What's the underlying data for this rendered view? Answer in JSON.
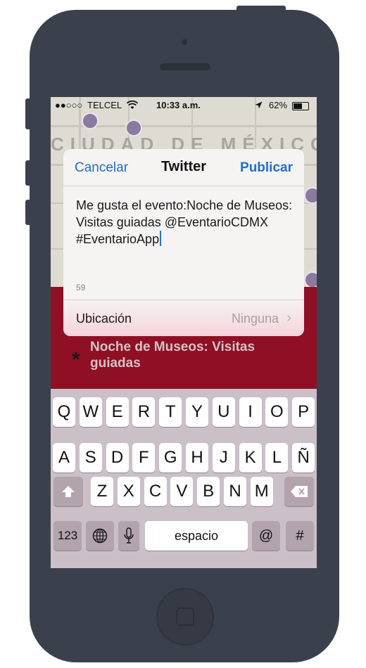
{
  "status_bar": {
    "signal": "●●○○○",
    "carrier": "TELCEL",
    "time": "10:33 a.m.",
    "battery_label": "62%",
    "battery_level": 0.62
  },
  "map": {
    "label": "CIUDAD DE MÉXICO"
  },
  "twitter_sheet": {
    "cancel_label": "Cancelar",
    "title": "Twitter",
    "publish_label": "Publicar",
    "tweet_text": "Me gusta el evento:Noche de Museos: Visitas guiadas @EventarioCDMX #EventarioApp",
    "char_count": "59",
    "location_label": "Ubicación",
    "location_value": "Ninguna"
  },
  "event": {
    "title": "Noche de Museos: Visitas guiadas"
  },
  "keyboard": {
    "row1": [
      "Q",
      "W",
      "E",
      "R",
      "T",
      "Y",
      "U",
      "I",
      "O",
      "P"
    ],
    "row2": [
      "A",
      "S",
      "D",
      "F",
      "G",
      "H",
      "J",
      "K",
      "L",
      "Ñ"
    ],
    "row3": [
      "Z",
      "X",
      "C",
      "V",
      "B",
      "N",
      "M"
    ],
    "numbers_label": "123",
    "space_label": "espacio",
    "at_label": "@",
    "hash_label": "#"
  },
  "colors": {
    "accent": "#1e6fd1",
    "event_band": "#8f1024",
    "phone_body": "#3b414c"
  }
}
